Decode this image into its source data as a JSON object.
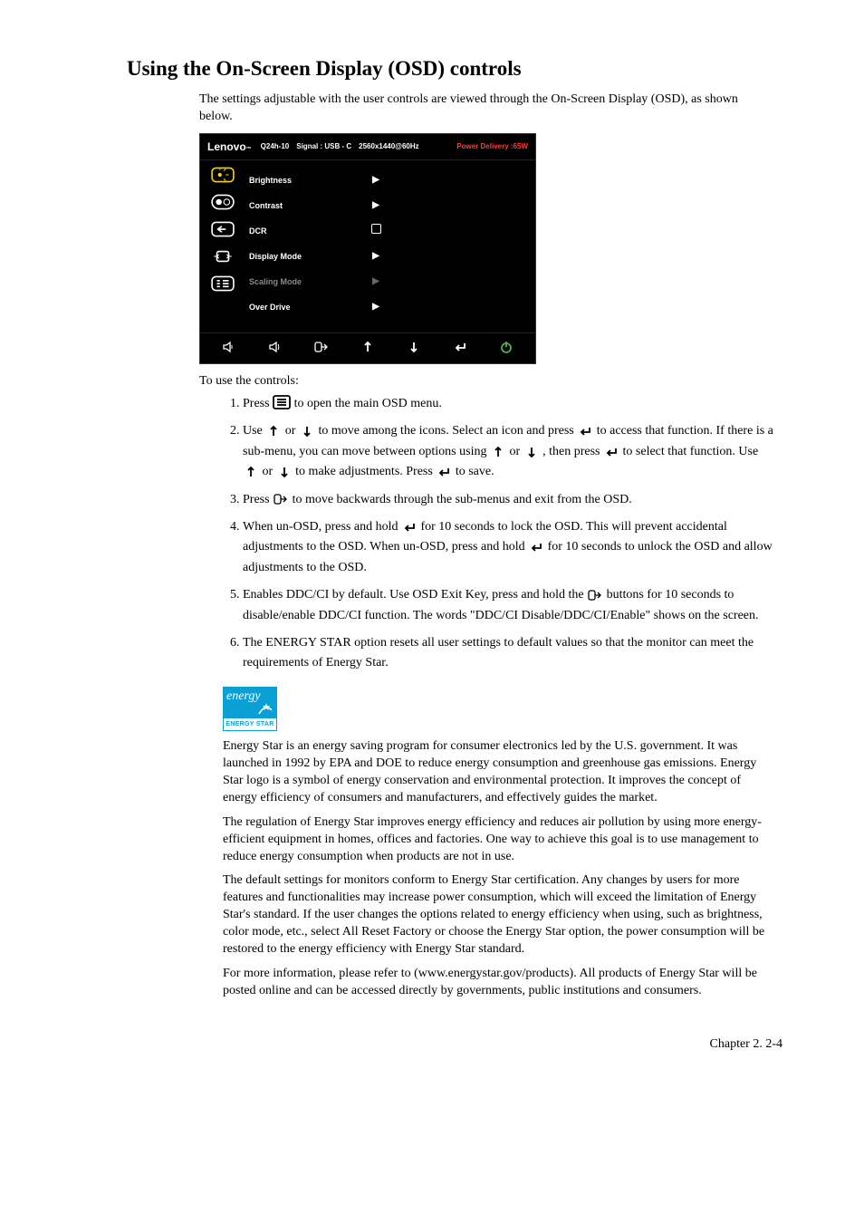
{
  "title": "Using the On-Screen Display (OSD) controls",
  "intro": "The settings adjustable with the user controls are viewed through the On-Screen Display (OSD), as shown below.",
  "osd": {
    "brand": "Lenovo",
    "model": "Q24h-10",
    "signal": "Signal : USB - C",
    "resolution": "2560x1440@60Hz",
    "power": "Power Delivery :65W",
    "menu": [
      {
        "label": "Brightness",
        "indicator": "play",
        "dim": false
      },
      {
        "label": "Contrast",
        "indicator": "play",
        "dim": false
      },
      {
        "label": "DCR",
        "indicator": "square",
        "dim": false
      },
      {
        "label": "Display Mode",
        "indicator": "play",
        "dim": false
      },
      {
        "label": "Scaling Mode",
        "indicator": "play",
        "dim": true
      },
      {
        "label": "Over Drive",
        "indicator": "play",
        "dim": false
      }
    ]
  },
  "controls_intro": "To use the controls:",
  "steps": {
    "s1_a": "Press ",
    "s1_b": " to open the main OSD menu.",
    "s2_a": "Use ",
    "s2_b": " or ",
    "s2_c": " to move among the icons. Select an icon and press ",
    "s2_d": " to access that function. If there is a sub-menu, you can move between options using ",
    "s2_e": " or ",
    "s2_f": ", then press ",
    "s2_g": " to select that function. Use ",
    "s2_h": " or ",
    "s2_i": " to make adjustments.    Press ",
    "s2_j": " to save.",
    "s3_a": "Press ",
    "s3_b": " to move backwards through the sub-menus and exit from the OSD.",
    "s4_a": "When un-OSD, press and hold ",
    "s4_b": " for 10 seconds to lock the OSD. This will prevent accidental adjustments to the OSD. When un-OSD, press and hold ",
    "s4_c": " for 10 seconds to unlock the OSD and allow adjustments to the OSD.",
    "s5_a": "Enables DDC/CI by default. Use OSD Exit Key, press and hold the ",
    "s5_b": " buttons for 10 seconds to disable/enable DDC/CI function. The words \"DDC/CI Disable/DDC/CI/Enable\" shows on the screen.",
    "s6": "The ENERGY STAR option resets all user settings to default values so that the monitor can meet the requirements of Energy Star."
  },
  "energy_logo_top": "energy",
  "energy_logo_bot": "ENERGY STAR",
  "p1": "Energy Star is an energy saving program for consumer electronics led by the U.S. government. It was launched in 1992 by EPA and DOE to reduce energy consumption and greenhouse gas emissions. Energy Star logo is a symbol of energy conservation and environmental protection. It improves the concept of energy efficiency of consumers and manufacturers, and effectively guides the market.",
  "p2": "The regulation of Energy Star improves energy efficiency and reduces air pollution by using more energy-efficient equipment in homes, offices and factories. One way to achieve this goal is to use management to reduce energy consumption when products are not in use.",
  "p3": "The default settings for monitors conform to Energy Star certification. Any changes by users for more features and functionalities may increase power consumption, which will exceed the limitation of Energy Star's standard. If the user changes the options related to energy efficiency when using, such as brightness, color mode, etc., select All Reset Factory or choose the Energy Star option, the power consumption will be restored to the energy efficiency with Energy Star standard.",
  "p4": "For more information, please refer to (www.energystar.gov/products). All products of Energy Star will be posted online and can be accessed directly by governments, public institutions and consumers.",
  "page": "Chapter  2.  2-4"
}
